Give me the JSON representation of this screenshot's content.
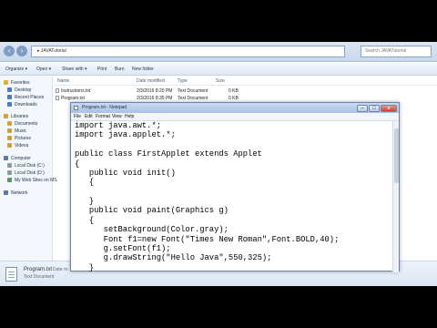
{
  "explorer": {
    "address": "▸ JAVATutorial",
    "search_placeholder": "Search JAVATutorial",
    "toolbar": [
      "Organize ▾",
      "Open ▾",
      "Share with ▾",
      "Print",
      "Burn",
      "New folder"
    ],
    "sidebar": [
      {
        "label": "Favorites",
        "icon": "star-icon",
        "color": "#e0b030"
      },
      {
        "label": "Desktop",
        "icon": "desktop-icon",
        "color": "#4a7ac0"
      },
      {
        "label": "Recent Places",
        "icon": "recent-icon",
        "color": "#4a7ac0"
      },
      {
        "label": "Downloads",
        "icon": "download-icon",
        "color": "#4a7ac0"
      },
      {
        "label": "Libraries",
        "icon": "library-icon",
        "color": "#d0a040"
      },
      {
        "label": "Documents",
        "icon": "documents-icon",
        "color": "#d0a040"
      },
      {
        "label": "Music",
        "icon": "music-icon",
        "color": "#d0a040"
      },
      {
        "label": "Pictures",
        "icon": "pictures-icon",
        "color": "#d0a040"
      },
      {
        "label": "Videos",
        "icon": "videos-icon",
        "color": "#d0a040"
      },
      {
        "label": "Computer",
        "icon": "computer-icon",
        "color": "#5a7aa0"
      },
      {
        "label": "Local Disk (C:)",
        "icon": "disk-icon",
        "color": "#8899aa"
      },
      {
        "label": "Local Disk (D:)",
        "icon": "disk-icon",
        "color": "#8899aa"
      },
      {
        "label": "My Web Sites on MS",
        "icon": "web-icon",
        "color": "#5a9a5a"
      },
      {
        "label": "Network",
        "icon": "network-icon",
        "color": "#5a7aa0"
      }
    ],
    "columns": [
      "Name",
      "Date modified",
      "Type",
      "Size"
    ],
    "files": [
      {
        "name": "Instructions.txt",
        "date": "2/3/2016 8:20 PM",
        "type": "Text Document",
        "size": "0 KB"
      },
      {
        "name": "Program.txt",
        "date": "2/3/2016 8:35 PM",
        "type": "Text Document",
        "size": "0 KB"
      }
    ],
    "details": {
      "name": "Program.txt",
      "type": "Text Document",
      "date_label": "Date m"
    }
  },
  "notepad": {
    "title": "Program.txt - Notepad",
    "menu": [
      "File",
      "Edit",
      "Format",
      "View",
      "Help"
    ],
    "code_lines": [
      "import java.awt.*;",
      "import java.applet.*;",
      "",
      "public class FirstApplet extends Applet",
      "{",
      "   public void init()",
      "   {",
      "",
      "   }",
      "   public void paint(Graphics g)",
      "   {",
      "      setBackground(Color.gray);",
      "      Font f1=new Font(\"Times New Roman\",Font.BOLD,40);",
      "      g.setFont(f1);",
      "      g.drawString(\"Hello Java\",550,325);",
      "   }"
    ]
  }
}
